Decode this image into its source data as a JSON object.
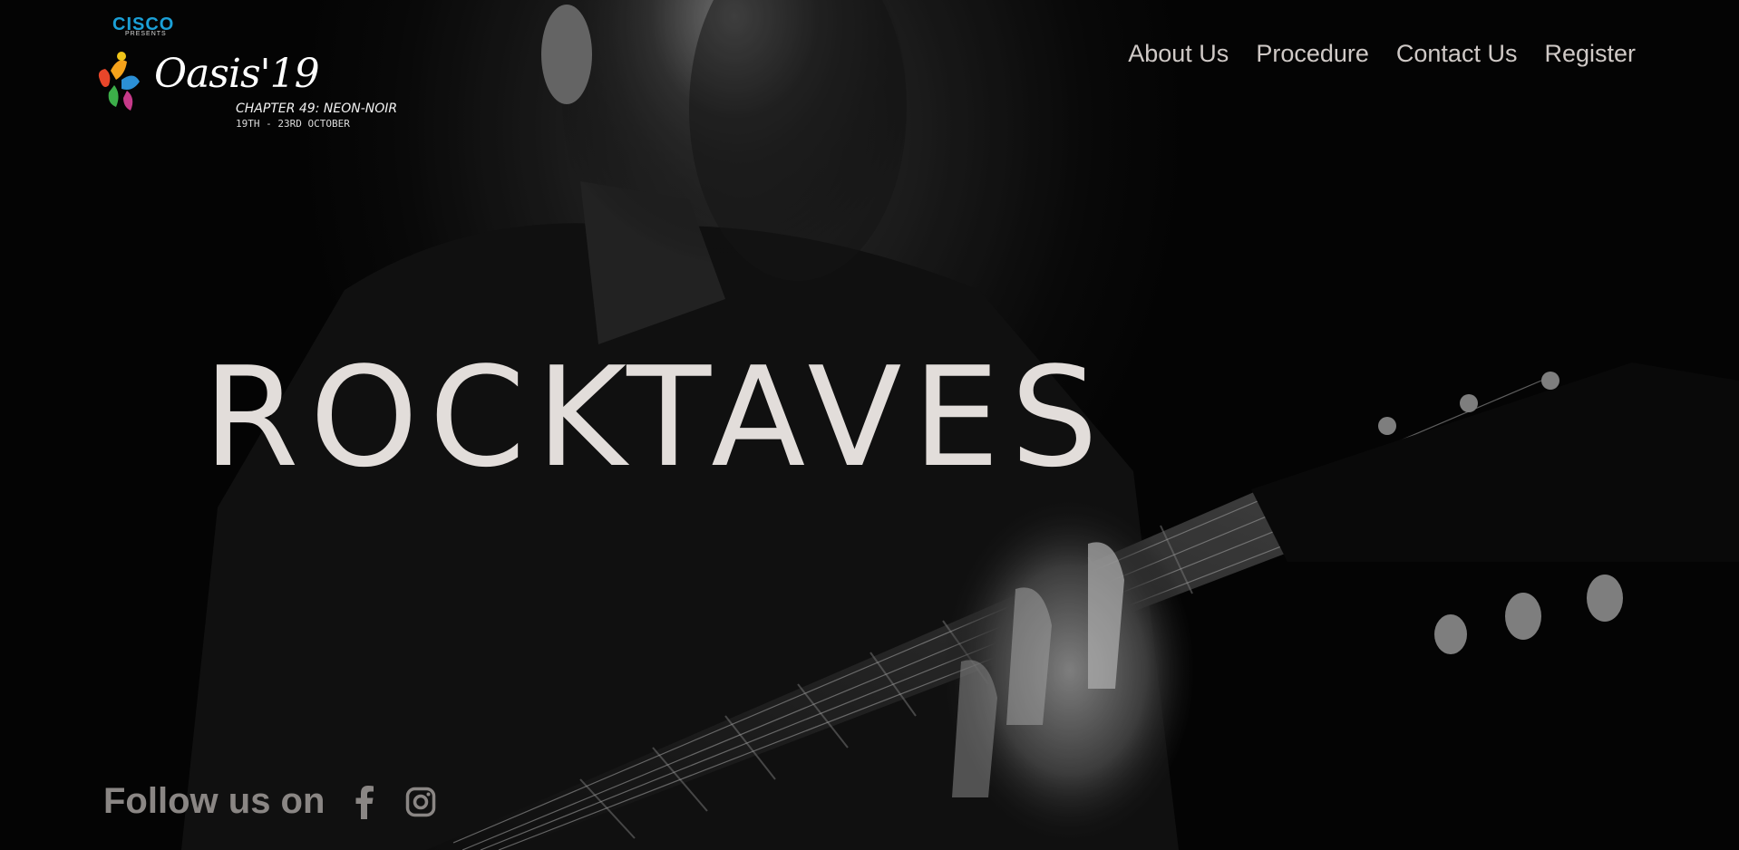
{
  "logo": {
    "cisco": "CISCO",
    "presents": "PRESENTS",
    "oasis": "Oasis'19",
    "chapter": "CHAPTER 49: NEON-NOIR",
    "dates": "19TH - 23RD OCTOBER"
  },
  "nav": {
    "items": [
      {
        "label": "About Us"
      },
      {
        "label": "Procedure"
      },
      {
        "label": "Contact Us"
      },
      {
        "label": "Register"
      }
    ]
  },
  "hero": {
    "headline": "ROCKTAVES"
  },
  "follow": {
    "label": "Follow us on",
    "icons": [
      "facebook-icon",
      "instagram-icon"
    ]
  },
  "colors": {
    "nav_text": "#cfc9c6",
    "headline": "#e2ddda",
    "follow_text": "#8a8684",
    "cisco_blue": "#1ba0d7",
    "background": "#050505"
  }
}
